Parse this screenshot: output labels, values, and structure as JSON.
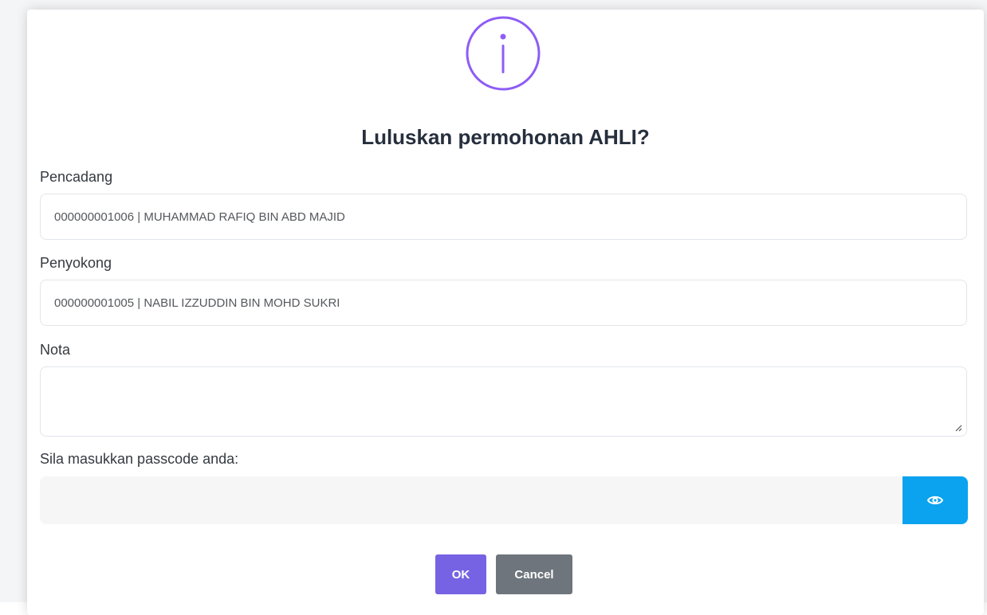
{
  "dialog": {
    "icon": "info-icon",
    "title": "Luluskan permohonan AHLI?",
    "fields": {
      "pencadang": {
        "label": "Pencadang",
        "value": "000000001006 | MUHAMMAD RAFIQ BIN ABD MAJID"
      },
      "penyokong": {
        "label": "Penyokong",
        "value": "000000001005 | NABIL IZZUDDIN BIN MOHD SUKRI"
      },
      "nota": {
        "label": "Nota",
        "value": ""
      },
      "passcode": {
        "label": "Sila masukkan passcode anda:",
        "value": "",
        "toggle_icon": "eye-icon"
      }
    },
    "buttons": {
      "ok": "OK",
      "cancel": "Cancel"
    },
    "colors": {
      "accent": "#7663e3",
      "eye_button": "#0ba3ef",
      "cancel_button": "#6e757c",
      "icon_border": "#8e5cf5"
    }
  }
}
